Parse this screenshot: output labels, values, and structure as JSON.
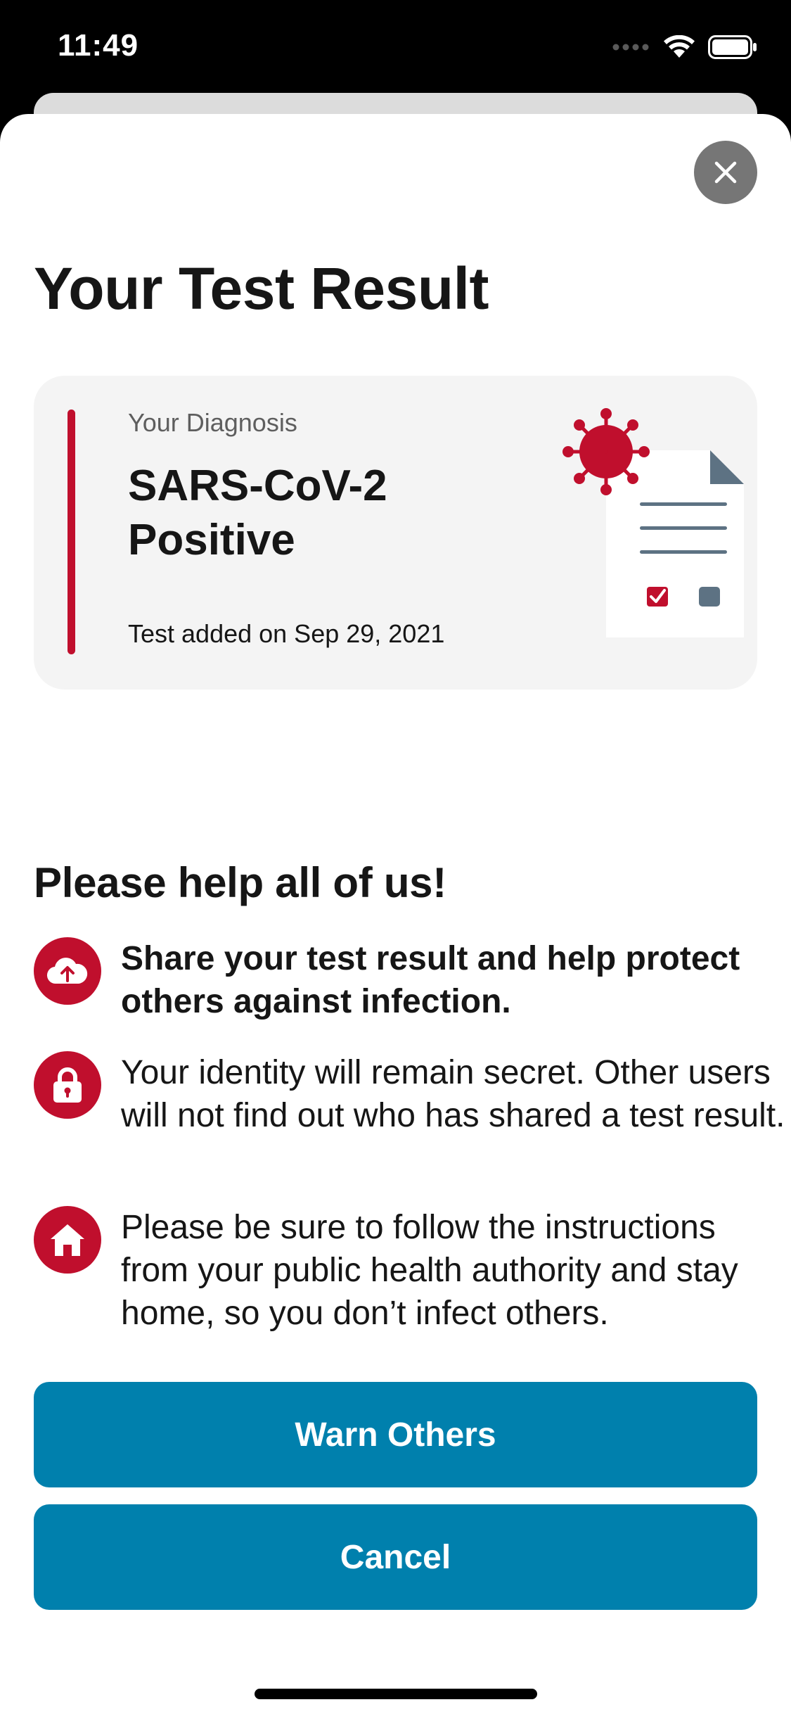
{
  "status_bar": {
    "time": "11:49"
  },
  "header": {
    "title": "Your Test Result"
  },
  "diagnosis_card": {
    "label": "Your Diagnosis",
    "value": "SARS-CoV-2 Positive",
    "date_text": "Test added on Sep 29, 2021",
    "accent_color": "#c00f2d"
  },
  "info_section": {
    "title": "Please help all of us!",
    "items": [
      {
        "icon": "cloud-upload-icon",
        "text": "Share your test result and help protect others against infection.",
        "bold": true
      },
      {
        "icon": "lock-icon",
        "text": "Your identity will remain secret. Other users will not find out who has shared a test result.",
        "bold": false
      },
      {
        "icon": "home-icon",
        "text": "Please be sure to follow the instructions from your public health authority and stay home, so you don’t infect others.",
        "bold": false
      }
    ]
  },
  "actions": {
    "primary_label": "Warn Others",
    "secondary_label": "Cancel",
    "button_color": "#0080ad"
  }
}
